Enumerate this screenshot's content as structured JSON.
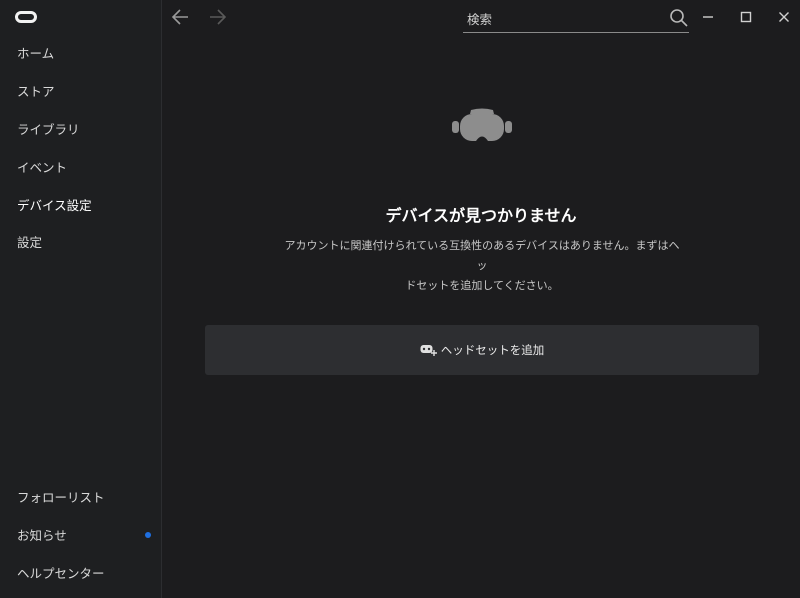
{
  "sidebar": {
    "logo": "oculus-logo",
    "items": [
      {
        "label": "ホーム"
      },
      {
        "label": "ストア"
      },
      {
        "label": "ライブラリ"
      },
      {
        "label": "イベント"
      },
      {
        "label": "デバイス設定",
        "active": true
      },
      {
        "label": "設定"
      }
    ],
    "bottom_items": [
      {
        "label": "フォローリスト"
      },
      {
        "label": "お知らせ",
        "has_notification": true
      },
      {
        "label": "ヘルプセンター"
      }
    ]
  },
  "topbar": {
    "back_icon": "arrow-left-icon",
    "forward_icon": "arrow-right-icon",
    "search": {
      "placeholder": "検索",
      "value": ""
    },
    "window_controls": [
      "minimize-icon",
      "maximize-icon",
      "close-icon"
    ]
  },
  "main": {
    "icon": "headset-icon",
    "title": "デバイスが見つかりません",
    "description_line1": "アカウントに関連付けられている互換性のあるデバイスはありません。まずはヘッ",
    "description_line2": "ドセットを追加してください。",
    "add_button": {
      "icon": "add-headset-icon",
      "label": "ヘッドセットを追加"
    }
  },
  "colors": {
    "background": "#1c1c1e",
    "sidebar": "#1e1f21",
    "button": "#2d2e31",
    "notification": "#1f6fe0"
  }
}
